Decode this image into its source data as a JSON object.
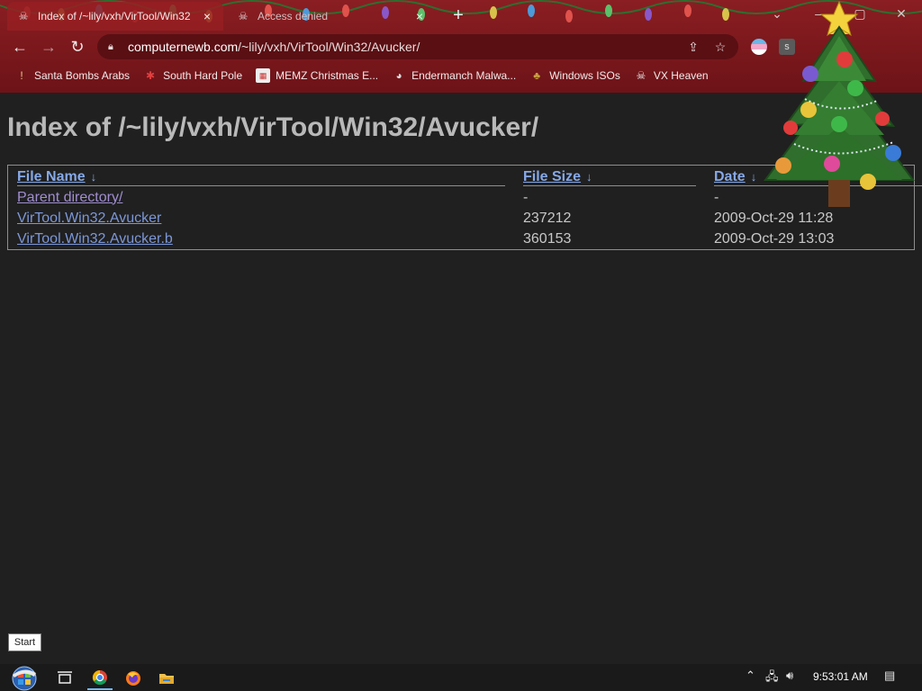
{
  "browser": {
    "tabs": [
      {
        "title": "Index of /~lily/vxh/VirTool/Win32",
        "active": true
      },
      {
        "title": "Access denied",
        "active": false
      }
    ],
    "address": {
      "host": "computernewb.com",
      "path": "/~lily/vxh/VirTool/Win32/Avucker/"
    },
    "bookmarks": [
      {
        "label": "Santa Bombs Arabs",
        "icon": "candle-icon"
      },
      {
        "label": "South Hard Pole",
        "icon": "snowflake-icon"
      },
      {
        "label": "MEMZ Christmas E...",
        "icon": "page-icon"
      },
      {
        "label": "Endermanch Malwa...",
        "icon": "raccoon-icon"
      },
      {
        "label": "Windows ISOs",
        "icon": "buddha-icon"
      },
      {
        "label": "VX Heaven",
        "icon": "skull-icon"
      }
    ]
  },
  "page": {
    "heading": "Index of /~lily/vxh/VirTool/Win32/Avucker/",
    "columns": {
      "name": "File Name",
      "size": "File Size",
      "date": "Date",
      "sort_arrow": "↓"
    },
    "rows": [
      {
        "name": "Parent directory/",
        "size": "-",
        "date": "-"
      },
      {
        "name": "VirTool.Win32.Avucker",
        "size": "237212",
        "date": "2009-Oct-29 11:28"
      },
      {
        "name": "VirTool.Win32.Avucker.b",
        "size": "360153",
        "date": "2009-Oct-29 13:03"
      }
    ]
  },
  "tooltip": {
    "label": "Start"
  },
  "taskbar": {
    "clock": "9:53:01 AM"
  },
  "colors": {
    "chrome": "#8a1e22",
    "link": "#7c97d8",
    "visited": "#a08ed0",
    "background": "#202020"
  }
}
